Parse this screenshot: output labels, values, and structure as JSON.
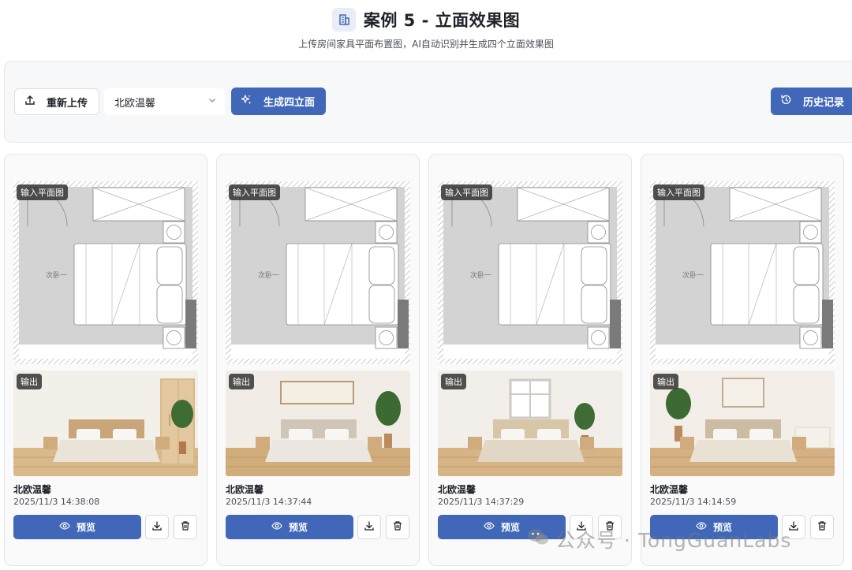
{
  "header": {
    "title": "案例 5 - 立面效果图",
    "subtitle": "上传房间家具平面布置图，AI自动识别并生成四个立面效果图"
  },
  "toolbar": {
    "upload_label": "重新上传",
    "style_value": "北欧温馨",
    "generate_label": "生成四立面",
    "history_label": "历史记录"
  },
  "labels": {
    "input_tag": "输入平面图",
    "output_tag": "输出",
    "preview": "预览",
    "room_label": "次卧一"
  },
  "cards": [
    {
      "style": "北欧温馨",
      "time": "2025/11/3 14:38:08"
    },
    {
      "style": "北欧温馨",
      "time": "2025/11/3 14:37:44"
    },
    {
      "style": "北欧温馨",
      "time": "2025/11/3 14:37:29"
    },
    {
      "style": "北欧温馨",
      "time": "2025/11/3 14:14:59"
    }
  ],
  "watermark": "公众号 · TongGuanLabs",
  "colors": {
    "accent": "#4168b8",
    "tag_bg": "#323232"
  }
}
